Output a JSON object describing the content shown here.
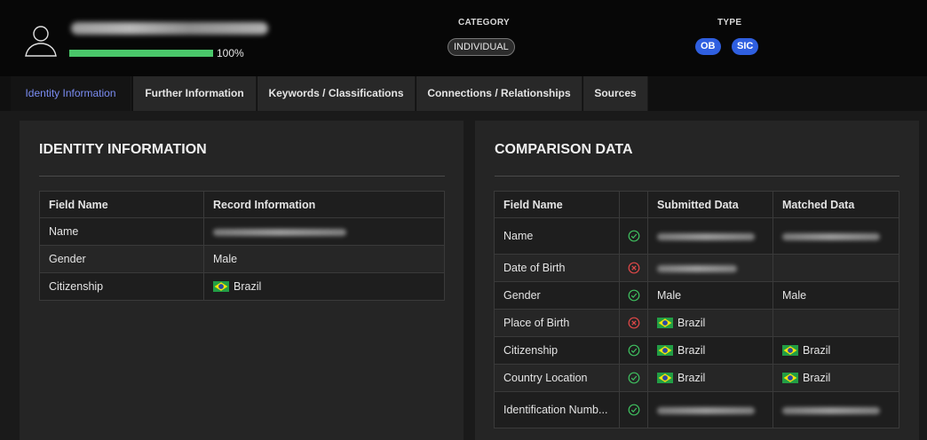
{
  "header": {
    "progress_text": "100%",
    "progress_fraction": 1.0,
    "category_label": "CATEGORY",
    "category_value": "INDIVIDUAL",
    "type_label": "TYPE",
    "type_values": [
      "OB",
      "SIC"
    ],
    "colors": {
      "progress": "#4ac76a",
      "type_pill": "#2f5fe0",
      "active_tab": "#7a8cf2"
    }
  },
  "tabs": [
    {
      "label": "Identity Information",
      "active": true
    },
    {
      "label": "Further Information",
      "active": false
    },
    {
      "label": "Keywords / Classifications",
      "active": false
    },
    {
      "label": "Connections / Relationships",
      "active": false
    },
    {
      "label": "Sources",
      "active": false
    }
  ],
  "identity": {
    "title": "IDENTITY INFORMATION",
    "columns": [
      "Field Name",
      "Record Information"
    ],
    "rows": [
      {
        "field": "Name",
        "value": "",
        "redacted": true
      },
      {
        "field": "Gender",
        "value": "Male"
      },
      {
        "field": "Citizenship",
        "value": "Brazil",
        "flag": "brazil-flag-icon"
      }
    ]
  },
  "comparison": {
    "title": "COMPARISON DATA",
    "columns": [
      "Field Name",
      "",
      "Submitted Data",
      "Matched Data"
    ],
    "rows": [
      {
        "field": "Name",
        "status": "match",
        "submitted": "",
        "matched": "",
        "redacted": true
      },
      {
        "field": "Date of Birth",
        "status": "mismatch",
        "submitted": "",
        "matched": "",
        "redacted_submitted": true
      },
      {
        "field": "Gender",
        "status": "match",
        "submitted": "Male",
        "matched": "Male"
      },
      {
        "field": "Place of Birth",
        "status": "mismatch",
        "submitted": "Brazil",
        "matched": ""
      },
      {
        "field": "Citizenship",
        "status": "match",
        "submitted": "Brazil",
        "matched": "Brazil"
      },
      {
        "field": "Country Location",
        "status": "match",
        "submitted": "Brazil",
        "matched": "Brazil"
      },
      {
        "field": "Identification Numb...",
        "status": "match",
        "submitted": "",
        "matched": "",
        "redacted": true
      }
    ]
  },
  "icons": {
    "match": "check-circle-icon",
    "mismatch": "x-circle-icon",
    "user": "user-avatar-icon"
  },
  "status_colors": {
    "match": "#3fbf5f",
    "mismatch": "#e04848"
  }
}
